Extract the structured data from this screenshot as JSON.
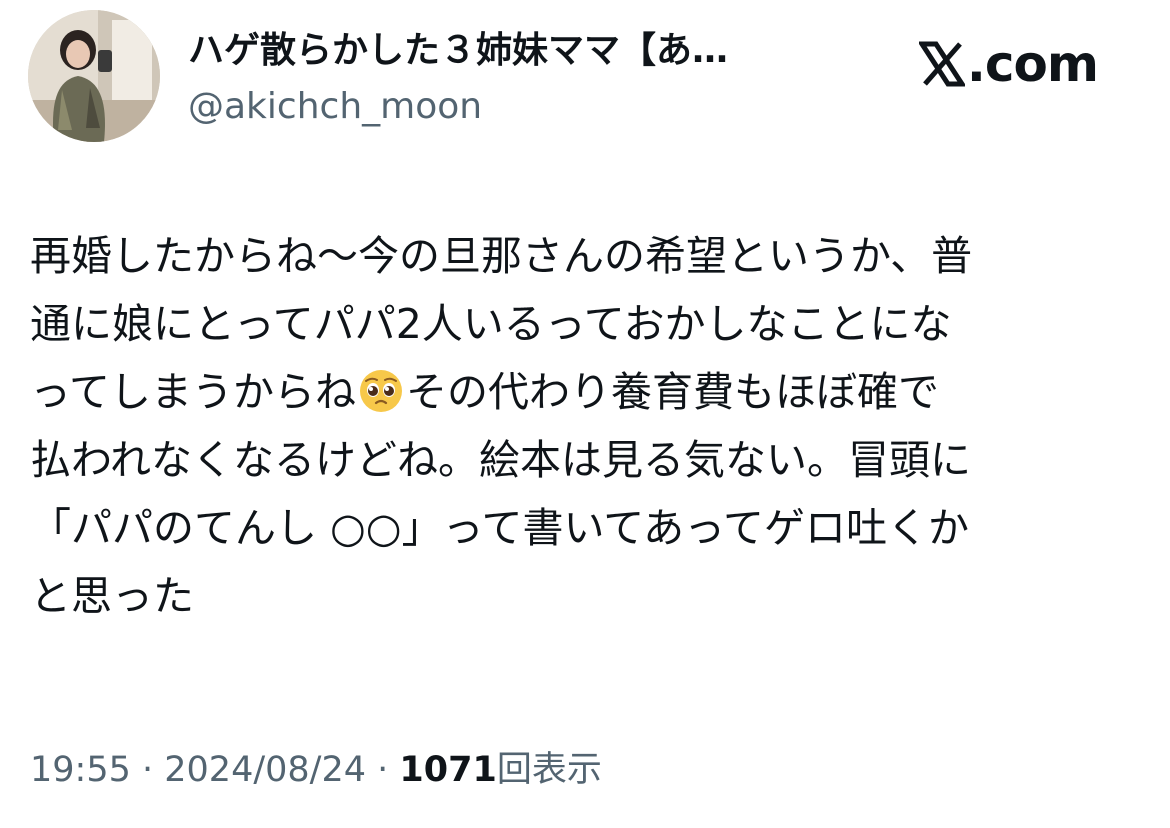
{
  "author": {
    "display_name": "ハゲ散らかした３姉妹ママ【あ…",
    "handle": "@akichch_moon",
    "avatar_icon": "profile-photo"
  },
  "brand": {
    "logo_icon": "x-logo-icon",
    "text": ".com"
  },
  "tweet": {
    "lines": [
      "再婚したからね〜今の旦那さんの希望というか、普",
      "通に娘にとってパパ2人いるっておかしなことにな",
      "ってしまうからね",
      "その代わり養育費もほぼ確で",
      "払われなくなるけどね。絵本は見る気ない。冒頭に",
      "「パパのてんし ○○」って書いてあってゲロ吐くか",
      "と思った"
    ],
    "emoji_icon": "pleading-face-emoji"
  },
  "meta": {
    "time": "19:55",
    "separator": " · ",
    "date": "2024/08/24",
    "views_count": "1071",
    "views_label": "回表示"
  }
}
